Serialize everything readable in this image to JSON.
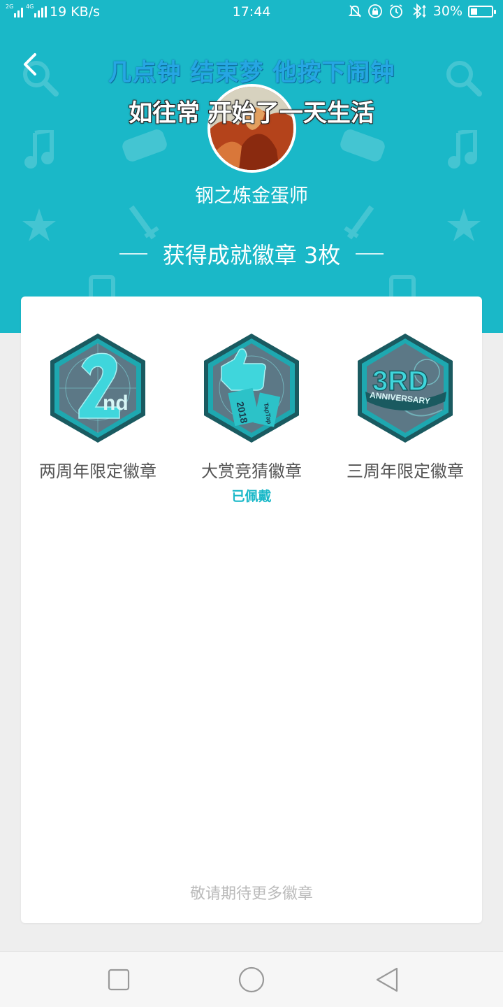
{
  "status_bar": {
    "sim1": "2G",
    "sim2": "4G",
    "speed": "19 KB/s",
    "time": "17:44",
    "battery": "30%",
    "icons": [
      "mute-icon",
      "lock-rotation-icon",
      "alarm-icon",
      "bluetooth-icon",
      "battery-icon"
    ]
  },
  "header": {
    "banner_line1": "几点钟 结束梦 他按下闹钟",
    "banner_line2": "如往常 开始了一天生活",
    "username": "钢之炼金蛋师",
    "achievement_text": "获得成就徽章 3枚",
    "background_color": "#1ab8c8"
  },
  "badges": [
    {
      "name": "两周年限定徽章",
      "worn": ""
    },
    {
      "name": "大赏竞猜徽章",
      "worn": "已佩戴"
    },
    {
      "name": "三周年限定徽章",
      "worn": ""
    }
  ],
  "badge_art": {
    "nd": "nd",
    "year_2018": "2018",
    "brand": "TapTap",
    "three_rd": "3RD",
    "anniversary": "ANNIVERSARY"
  },
  "more_text": "敬请期待更多徽章",
  "accent_color": "#1ab8c8"
}
